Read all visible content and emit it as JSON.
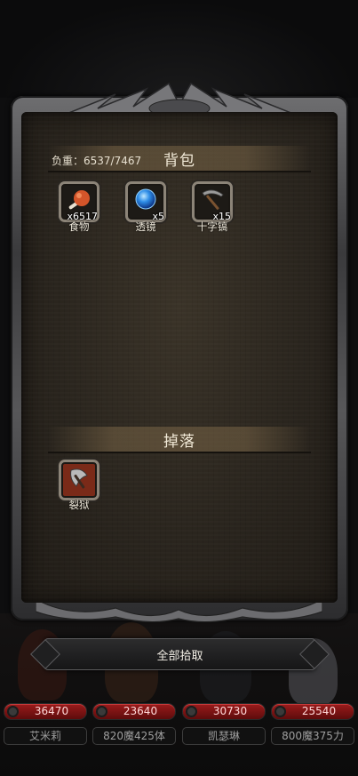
{
  "backpack": {
    "title": "背包",
    "weight_label": "负重：6537/7467",
    "items": [
      {
        "name": "食物",
        "qty": "x6517",
        "icon": "meat-icon"
      },
      {
        "name": "透镜",
        "qty": "x5",
        "icon": "lens-orb-icon"
      },
      {
        "name": "十字镐",
        "qty": "x15",
        "icon": "pickaxe-icon"
      }
    ]
  },
  "drops": {
    "title": "掉落",
    "items": [
      {
        "name": "裂狱",
        "qty": "",
        "icon": "axe-icon"
      }
    ]
  },
  "pickup_all_label": "全部拾取",
  "party": [
    {
      "hp": "36470",
      "name": "艾米莉"
    },
    {
      "hp": "23640",
      "name": "820魔425体"
    },
    {
      "hp": "30730",
      "name": "凯瑟琳"
    },
    {
      "hp": "25540",
      "name": "800魔375力"
    }
  ],
  "colors": {
    "hp_bar": "#8a1414",
    "panel": "#2e2820",
    "frame": "#5a5a5c"
  }
}
